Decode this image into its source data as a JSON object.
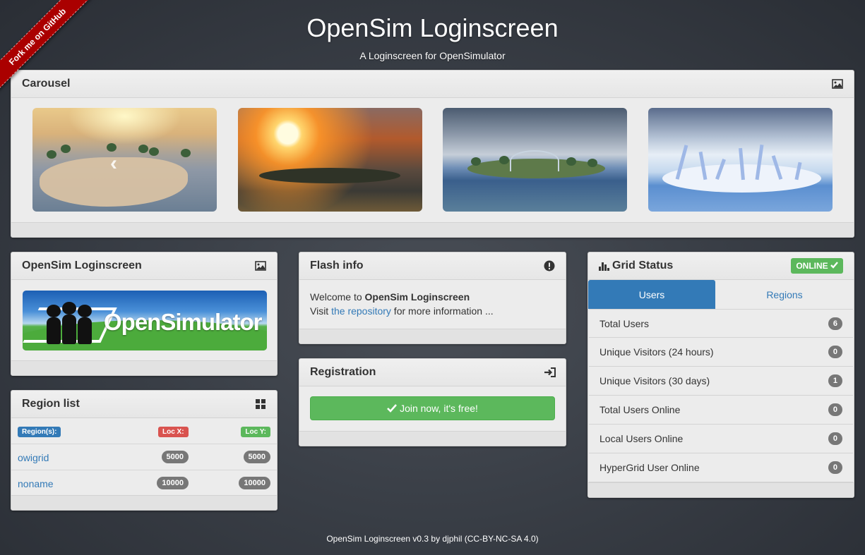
{
  "ribbon": {
    "label": "Fork me on GitHub"
  },
  "header": {
    "title": "OpenSim Loginscreen",
    "subtitle": "A Loginscreen for OpenSimulator"
  },
  "carousel": {
    "title": "Carousel",
    "icon": "image-icon",
    "prev_icon": "chevron-left-icon"
  },
  "opensim_panel": {
    "title": "OpenSim Loginscreen",
    "icon": "image-icon",
    "logo_text": "OpenSimulator"
  },
  "region_list": {
    "title": "Region list",
    "icon": "grid-icon",
    "headers": {
      "region": "Region(s):",
      "loc_x": "Loc X:",
      "loc_y": "Loc Y:"
    },
    "rows": [
      {
        "name": "owigrid",
        "x": "5000",
        "y": "5000"
      },
      {
        "name": "noname",
        "x": "10000",
        "y": "10000"
      }
    ]
  },
  "flash_info": {
    "title": "Flash info",
    "icon": "exclamation-circle-icon",
    "welcome_prefix": "Welcome to ",
    "welcome_bold": "OpenSim Loginscreen",
    "visit_prefix": "Visit ",
    "repo_link": "the repository",
    "visit_suffix": " for more information ..."
  },
  "registration": {
    "title": "Registration",
    "icon": "sign-in-icon",
    "button_label": "Join now, it's free!"
  },
  "grid_status": {
    "title": "Grid Status",
    "icon": "bar-chart-icon",
    "status": "ONLINE",
    "status_color": "#5cb85c",
    "tabs": [
      "Users",
      "Regions"
    ],
    "active_tab": "Users",
    "items": [
      {
        "label": "Total Users",
        "count": "6"
      },
      {
        "label": "Unique Visitors (24 hours)",
        "count": "0"
      },
      {
        "label": "Unique Visitors (30 days)",
        "count": "1"
      },
      {
        "label": "Total Users Online",
        "count": "0"
      },
      {
        "label": "Local Users Online",
        "count": "0"
      },
      {
        "label": "HyperGrid User Online",
        "count": "0"
      }
    ]
  },
  "footer": {
    "text": "OpenSim Loginscreen v0.3 by djphil (CC-BY-NC-SA 4.0)"
  },
  "colors": {
    "primary": "#337ab7",
    "success": "#5cb85c",
    "danger": "#d9534f",
    "ribbon": "#aa0000"
  }
}
